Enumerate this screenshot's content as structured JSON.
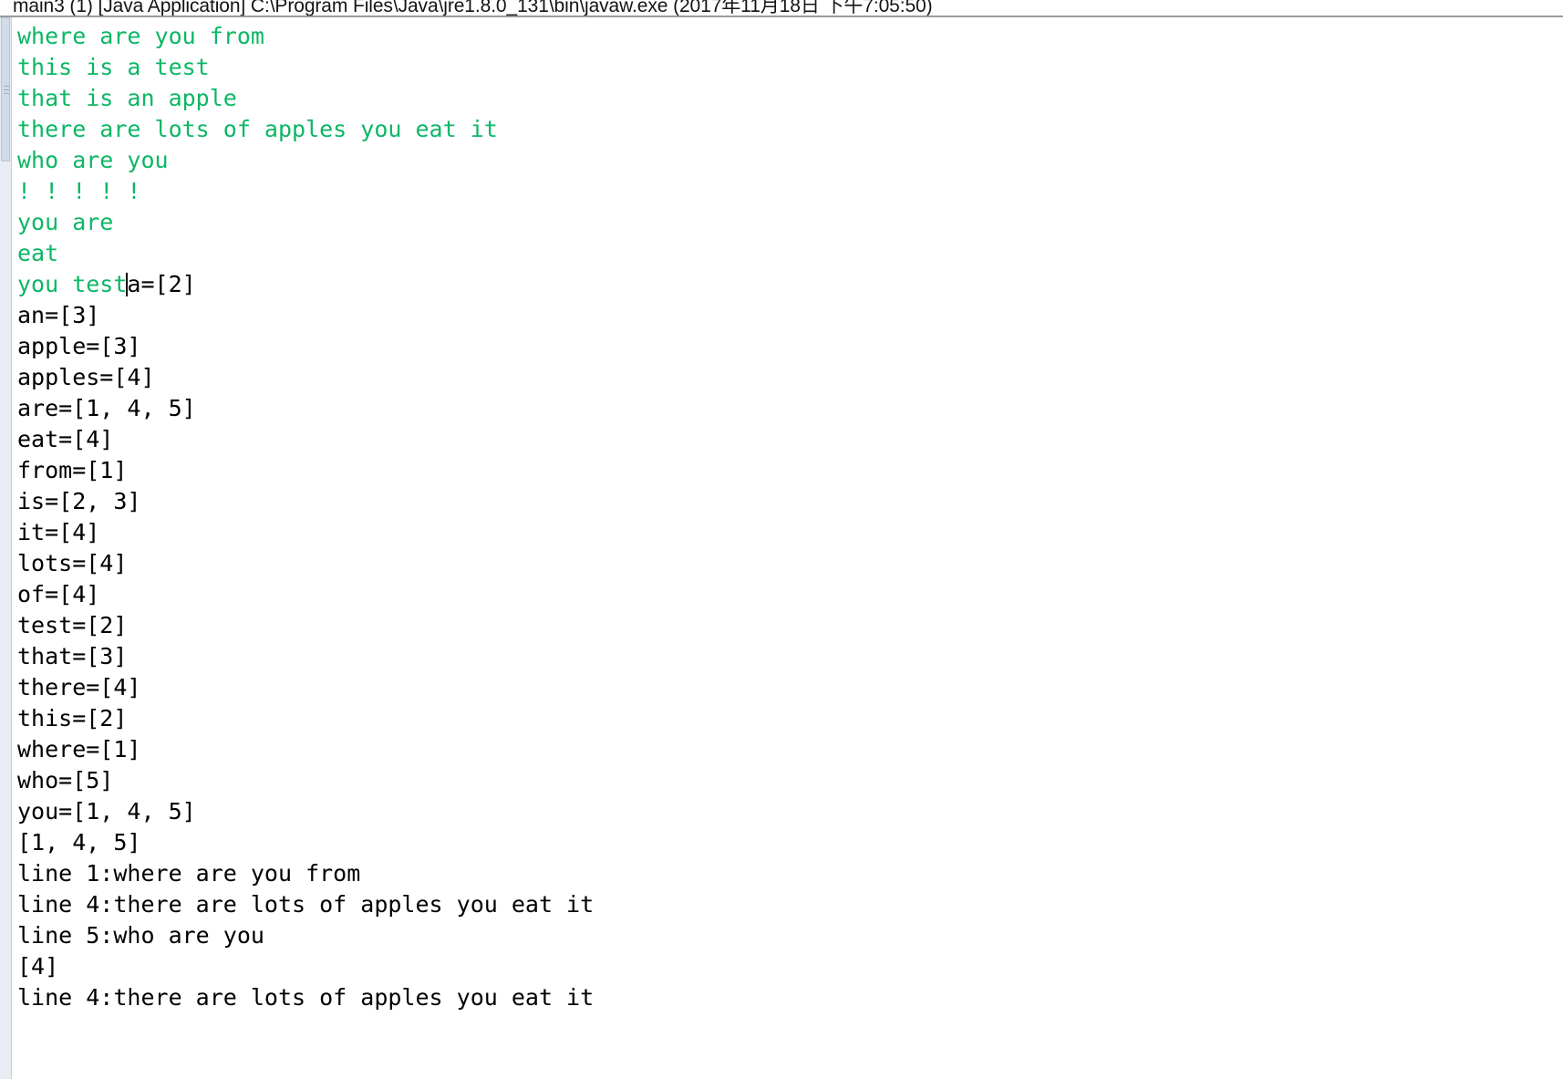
{
  "window": {
    "title": "main3 (1) [Java Application] C:\\Program Files\\Java\\jre1.8.0_131\\bin\\javaw.exe (2017年11月18日 下午7:05:50)",
    "app_name": "main3 (1)",
    "launch_type": "[Java Application]",
    "executable_path": "C:\\Program Files\\Java\\jre1.8.0_131\\bin\\javaw.exe",
    "timestamp": "(2017年11月18日 下午7:05:50)"
  },
  "colors": {
    "stdin_green": "#0cb764",
    "stdout_black": "#000000",
    "background": "#ffffff",
    "title_rule": "#9a9a9a",
    "scrollbar_track": "#e8edf4",
    "scrollbar_thumb": "#d2dbe7"
  },
  "console": {
    "caret_after_line_index": 8,
    "caret_after_text": "you test",
    "lines": [
      {
        "text": "where are you from",
        "stream": "green"
      },
      {
        "text": "this is a test",
        "stream": "green"
      },
      {
        "text": "that is an apple",
        "stream": "green"
      },
      {
        "text": "there are lots of apples you eat it",
        "stream": "green"
      },
      {
        "text": "who are you",
        "stream": "green"
      },
      {
        "text": "! ! ! ! !",
        "stream": "green"
      },
      {
        "text": "you are",
        "stream": "green"
      },
      {
        "text": "eat",
        "stream": "green"
      },
      {
        "text": "you test",
        "stream": "green",
        "caret": true,
        "tail": "a=[2]",
        "tail_stream": "black"
      },
      {
        "text": "an=[3]",
        "stream": "black"
      },
      {
        "text": "apple=[3]",
        "stream": "black"
      },
      {
        "text": "apples=[4]",
        "stream": "black"
      },
      {
        "text": "are=[1, 4, 5]",
        "stream": "black"
      },
      {
        "text": "eat=[4]",
        "stream": "black"
      },
      {
        "text": "from=[1]",
        "stream": "black"
      },
      {
        "text": "is=[2, 3]",
        "stream": "black"
      },
      {
        "text": "it=[4]",
        "stream": "black"
      },
      {
        "text": "lots=[4]",
        "stream": "black"
      },
      {
        "text": "of=[4]",
        "stream": "black"
      },
      {
        "text": "test=[2]",
        "stream": "black"
      },
      {
        "text": "that=[3]",
        "stream": "black"
      },
      {
        "text": "there=[4]",
        "stream": "black"
      },
      {
        "text": "this=[2]",
        "stream": "black"
      },
      {
        "text": "where=[1]",
        "stream": "black"
      },
      {
        "text": "who=[5]",
        "stream": "black"
      },
      {
        "text": "you=[1, 4, 5]",
        "stream": "black"
      },
      {
        "text": "[1, 4, 5]",
        "stream": "black"
      },
      {
        "text": "line 1:where are you from",
        "stream": "black"
      },
      {
        "text": "line 4:there are lots of apples you eat it",
        "stream": "black"
      },
      {
        "text": "line 5:who are you",
        "stream": "black"
      },
      {
        "text": "[4]",
        "stream": "black"
      },
      {
        "text": "line 4:there are lots of apples you eat it",
        "stream": "black"
      }
    ]
  }
}
